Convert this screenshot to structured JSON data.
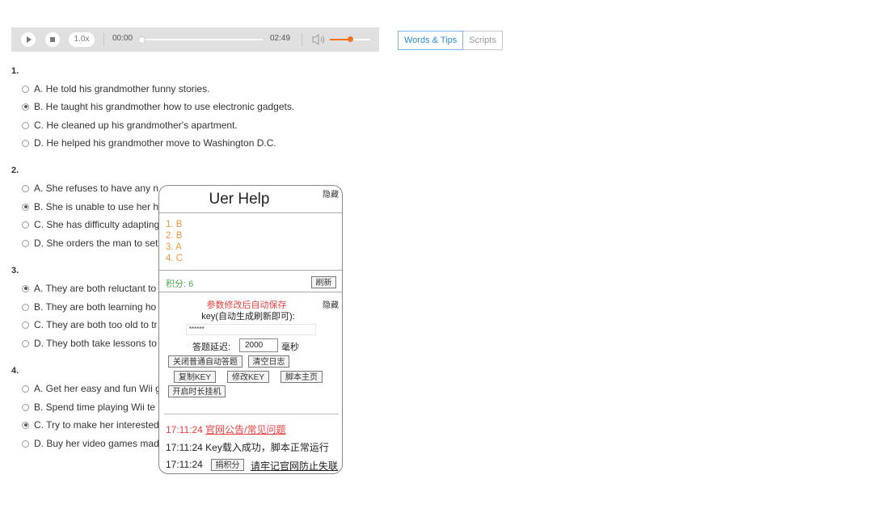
{
  "player": {
    "speed": "1.0x",
    "current_time": "00:00",
    "duration": "02:49",
    "progress_fraction": 0.0,
    "volume_fraction": 0.5,
    "accent_color": "#f0731e",
    "icons": [
      "play-icon",
      "stop-icon",
      "volume-icon"
    ]
  },
  "tabs": [
    {
      "label": "Words & Tips",
      "active": true
    },
    {
      "label": "Scripts",
      "active": false
    }
  ],
  "questions": [
    {
      "number": "1.",
      "options": [
        {
          "text": "A. He told his grandmother funny stories.",
          "selected": false
        },
        {
          "text": "B. He taught his grandmother how to use electronic gadgets.",
          "selected": true
        },
        {
          "text": "C. He cleaned up his grandmother's apartment.",
          "selected": false
        },
        {
          "text": "D. He helped his grandmother move to Washington D.C.",
          "selected": false
        }
      ]
    },
    {
      "number": "2.",
      "options": [
        {
          "text": "A. She refuses to have any n",
          "selected": false
        },
        {
          "text": "B. She is unable to use her h",
          "selected": true
        },
        {
          "text": "C. She has difficulty adapting",
          "selected": false
        },
        {
          "text": "D. She orders the man to set",
          "selected": false
        }
      ]
    },
    {
      "number": "3.",
      "options": [
        {
          "text": "A. They are both reluctant to",
          "selected": true
        },
        {
          "text": "B. They are both learning ho",
          "selected": false
        },
        {
          "text": "C. They are both too old to tr",
          "selected": false
        },
        {
          "text": "D. They both take lessons to",
          "selected": false
        }
      ]
    },
    {
      "number": "4.",
      "options": [
        {
          "text": "A. Get her easy and fun Wii g",
          "selected": false
        },
        {
          "text": "B. Spend time playing Wii te",
          "selected": false
        },
        {
          "text": "C. Try to make her interested",
          "selected": true
        },
        {
          "text": "D. Buy her video games mad",
          "selected": false
        }
      ]
    }
  ],
  "helper": {
    "title": "Uer Help",
    "hide_label": "隐藏",
    "answers": [
      "1. B",
      "2. B",
      "3. A",
      "4. C"
    ],
    "score_text": "积分: 6",
    "refresh_label": "刷新",
    "settings": {
      "hide_label": "隐藏",
      "save_note": "参数修改后自动保存",
      "key_label": "key(自动生成刷新即可):",
      "key_value": "******",
      "delay_label": "答题延迟:",
      "delay_value": "2000",
      "delay_unit": "毫秒",
      "buttons": {
        "close_auto": "关闭普通自动答题",
        "clear_log": "清空日志",
        "copy_key": "复制KEY",
        "edit_key": "修改KEY",
        "home": "脚本主页",
        "long_hang": "开启时长挂机"
      }
    },
    "log": [
      {
        "time": "17:11:24",
        "text": "官网公告/常见问题"
      },
      {
        "time": "17:11:24",
        "text": "Key载入成功，脚本正常运行"
      },
      {
        "time": "17:11:24",
        "button": "捐积分",
        "text": "请牢记官网防止失联"
      }
    ]
  }
}
